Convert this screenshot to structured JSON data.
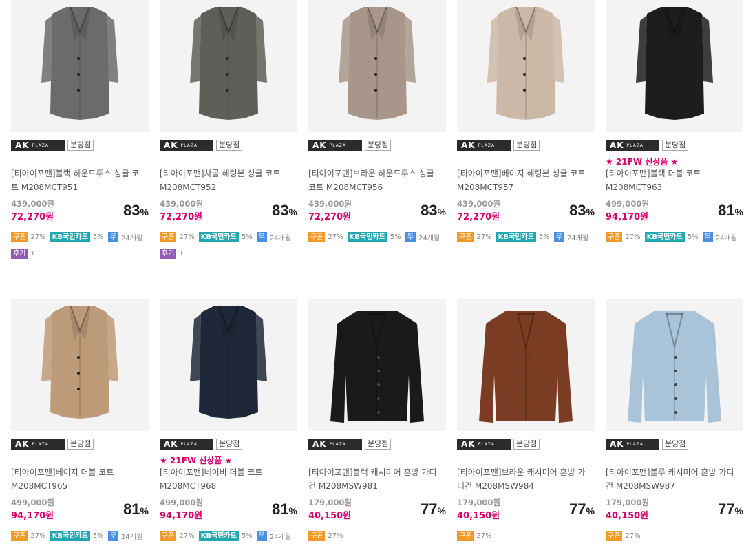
{
  "brand": {
    "logo_main": "AK",
    "logo_sub": "PLAZA",
    "branch_label": "분당점"
  },
  "tag_labels": {
    "coupon": "쿠폰",
    "kb_card": "KB국민카드",
    "installment": "무",
    "review": "후기"
  },
  "colors": {
    "price": "#d4006f",
    "coupon": "#f29a27",
    "kb": "#21a7b0",
    "installment": "#4a90e2",
    "review": "#8e5bb5",
    "new_tag": "#d4006f"
  },
  "products": [
    {
      "name": "[티아이포맨]블랙 하운드투스 싱글 코트 M208MCT951",
      "original_price": "439,000원",
      "price": "72,270원",
      "discount": "83",
      "discount_unit": "%",
      "new_tag": "",
      "coupon": "27%",
      "kb": "5%",
      "installment": "24개월",
      "review_count": "1",
      "icon": "coat",
      "color": "#6b6b6b"
    },
    {
      "name": "[티아이포맨]차콜 헤링본 싱글 코트 M208MCT952",
      "original_price": "439,000원",
      "price": "72,270원",
      "discount": "83",
      "discount_unit": "%",
      "new_tag": "",
      "coupon": "27%",
      "kb": "5%",
      "installment": "24개월",
      "review_count": "1",
      "icon": "coat",
      "color": "#5f5f59"
    },
    {
      "name": "[티아이포맨]브라운 하운드투스 싱글 코트 M208MCT956",
      "original_price": "439,000원",
      "price": "72,270원",
      "discount": "83",
      "discount_unit": "%",
      "new_tag": "",
      "coupon": "27%",
      "kb": "5%",
      "installment": "24개월",
      "review_count": "",
      "icon": "coat",
      "color": "#a8968a"
    },
    {
      "name": "[티아이포맨]베이지 헤링본 싱글 코트 M208MCT957",
      "original_price": "439,000원",
      "price": "72,270원",
      "discount": "83",
      "discount_unit": "%",
      "new_tag": "",
      "coupon": "27%",
      "kb": "5%",
      "installment": "24개월",
      "review_count": "",
      "icon": "coat",
      "color": "#cbb8a6"
    },
    {
      "name": "[티아이포맨]블랙 더블 코트 M208MCT963",
      "original_price": "499,000원",
      "price": "94,170원",
      "discount": "81",
      "discount_unit": "%",
      "new_tag": "★ 21FW 신상품 ★",
      "coupon": "27%",
      "kb": "5%",
      "installment": "24개월",
      "review_count": "",
      "icon": "coat",
      "color": "#1d1d1d"
    },
    {
      "name": "[티아이포맨]베이지 더블 코트 M208MCT965",
      "original_price": "499,000원",
      "price": "94,170원",
      "discount": "81",
      "discount_unit": "%",
      "new_tag": "",
      "coupon": "27%",
      "kb": "5%",
      "installment": "24개월",
      "review_count": "",
      "icon": "coat",
      "color": "#bd9a78"
    },
    {
      "name": "[티아이포맨]네이비 더블 코트 M208MCT968",
      "original_price": "499,000원",
      "price": "94,170원",
      "discount": "81",
      "discount_unit": "%",
      "new_tag": "★ 21FW 신상품 ★",
      "coupon": "27%",
      "kb": "5%",
      "installment": "24개월",
      "review_count": "",
      "icon": "coat",
      "color": "#1f2838"
    },
    {
      "name": "[티아이포맨]블랙 캐시미어 혼방 가디건 M208MSW981",
      "original_price": "179,000원",
      "price": "40,150원",
      "discount": "77",
      "discount_unit": "%",
      "new_tag": "",
      "coupon": "27%",
      "kb": "",
      "installment": "",
      "review_count": "",
      "icon": "cardigan",
      "color": "#1a1a1a"
    },
    {
      "name": "[티아이포맨]브라운 캐시미어 혼방 가디건 M208MSW984",
      "original_price": "179,000원",
      "price": "40,150원",
      "discount": "77",
      "discount_unit": "%",
      "new_tag": "",
      "coupon": "27%",
      "kb": "",
      "installment": "",
      "review_count": "",
      "icon": "cardigan",
      "color": "#7a3c22"
    },
    {
      "name": "[티아이포맨]블루 캐시미어 혼방 가디건 M208MSW987",
      "original_price": "179,000원",
      "price": "40,150원",
      "discount": "77",
      "discount_unit": "%",
      "new_tag": "",
      "coupon": "27%",
      "kb": "",
      "installment": "",
      "review_count": "",
      "icon": "cardigan",
      "color": "#a9c3d8"
    }
  ]
}
